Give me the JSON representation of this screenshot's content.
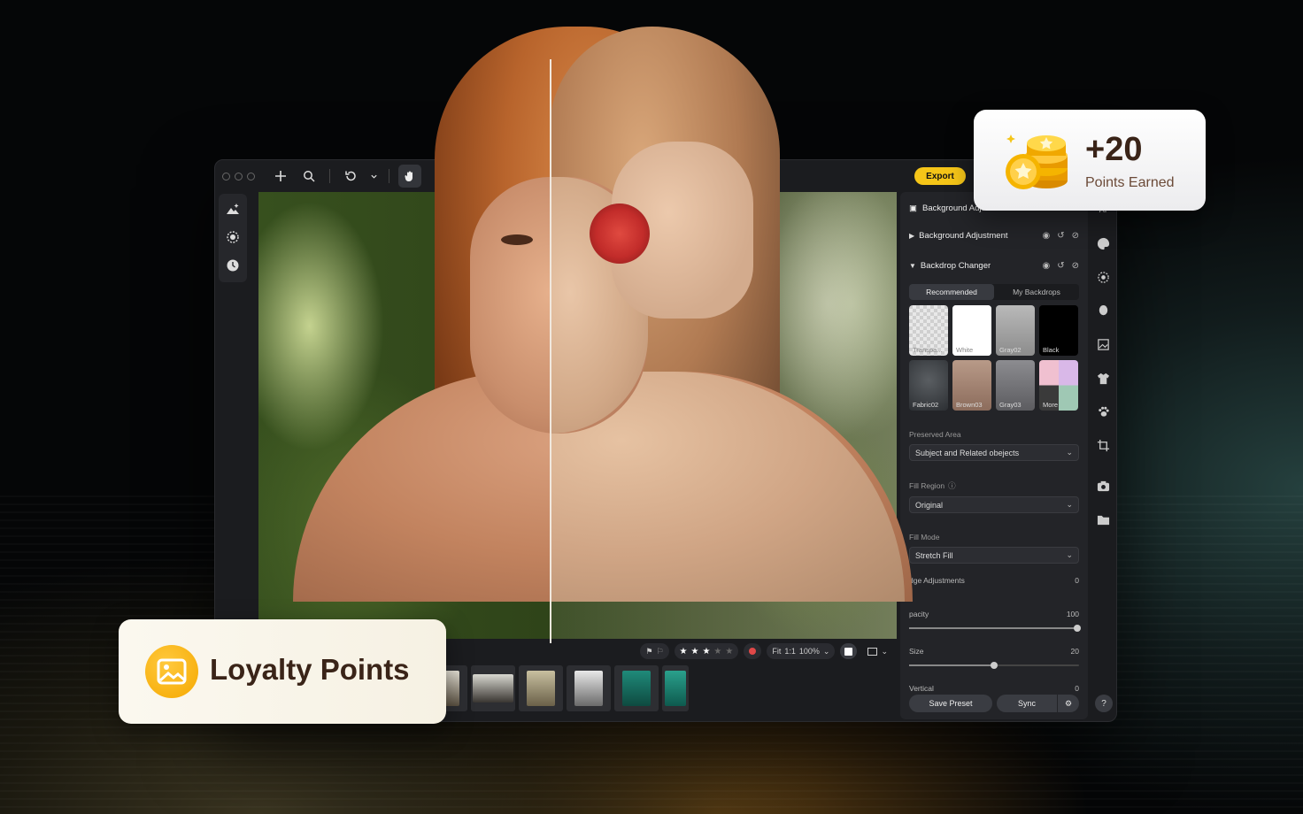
{
  "toolbar": {
    "export_label": "Export"
  },
  "panel": {
    "header": "Background Adjustments",
    "background_adjustment": "Background Adjustment",
    "backdrop_changer": "Backdrop Changer",
    "tabs": [
      "Recommended",
      "My Backdrops"
    ],
    "backdrops": [
      {
        "label": "Transpa...",
        "style": "checker"
      },
      {
        "label": "White",
        "style": "white",
        "selected": true
      },
      {
        "label": "Gray02",
        "style": "gray02"
      },
      {
        "label": "Black",
        "style": "black"
      },
      {
        "label": "Fabric02",
        "style": "fabric"
      },
      {
        "label": "Brown03",
        "style": "brown"
      },
      {
        "label": "Gray03",
        "style": "gray03"
      },
      {
        "label": "More",
        "style": "more"
      }
    ],
    "preserved_area_label": "Preserved Area",
    "preserved_area_value": "Subject and Related obejects",
    "fill_region_label": "Fill Region",
    "fill_region_value": "Original",
    "fill_mode_label": "Fill Mode",
    "fill_mode_value": "Stretch Fill",
    "edge_label": "dge Adjustments",
    "edge_value": "0",
    "opacity_label": "pacity",
    "opacity_value": "100",
    "size_label": "Size",
    "size_value": "20",
    "vertical_label": "Vertical",
    "vertical_value": "0",
    "save_preset": "Save Preset",
    "sync": "Sync"
  },
  "filmstrip": {
    "fit": "Fit",
    "one_to_one": "1:1",
    "zoom": "100%",
    "rating": 3,
    "max_rating": 5
  },
  "points_card": {
    "value": "+20",
    "caption": "Points Earned"
  },
  "loyalty_card": {
    "title": "Loyalty Points"
  },
  "colors": {
    "accent": "#f5c518",
    "panel_bg": "#232428",
    "window_bg": "#1b1c1f"
  }
}
